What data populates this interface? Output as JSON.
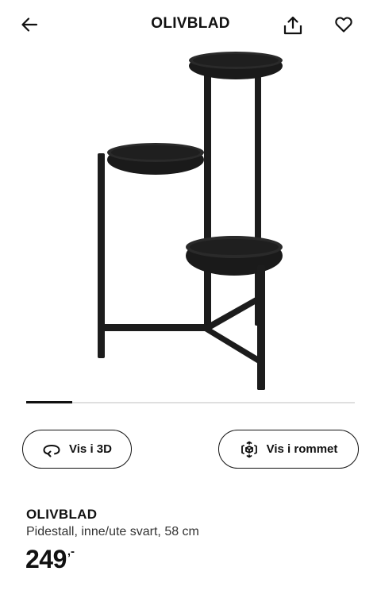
{
  "header": {
    "title": "OLIVBLAD",
    "back_icon": "arrow-left-icon",
    "share_icon": "share-icon",
    "favorite_icon": "heart-icon"
  },
  "gallery": {
    "image_subject": "black three-tier plant stand",
    "progress": 0.14
  },
  "actions": {
    "view_3d_label": "Vis i 3D",
    "view_3d_icon": "rotate-icon",
    "view_room_label": "Vis i rommet",
    "view_room_icon": "ar-cube-icon"
  },
  "product": {
    "name": "OLIVBLAD",
    "description": "Pidestall, inne/ute svart, 58 cm",
    "price": "249",
    "price_suffix": ",-"
  },
  "colors": {
    "text": "#111111",
    "product_metal": "#1c1c1c",
    "track": "#dfdfdf"
  }
}
